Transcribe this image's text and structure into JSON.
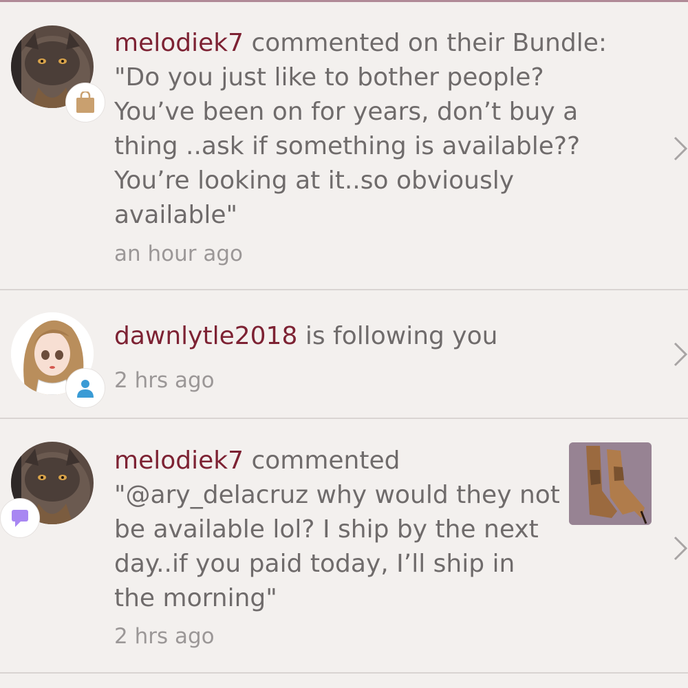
{
  "feed": {
    "items": [
      {
        "username": "melodiek7",
        "action": " commented on their Bundle:",
        "comment": "\"Do you just like to bother people? You’ve been on for years, don’t buy a thing ..ask if something is available?? You’re looking at it..so obviously available\"",
        "time": "an hour ago",
        "avatar": "cat-avatar",
        "badge_icon": "shopping-bag-icon",
        "badge_color": "#c9a06f"
      },
      {
        "username": "dawnlytle2018",
        "action": " is following you",
        "time": "2 hrs ago",
        "avatar": "cartoon-girl-avatar",
        "badge_icon": "person-icon",
        "badge_color": "#3a9bd5"
      },
      {
        "username": "melodiek7",
        "action": " commented",
        "comment": "\"@ary_delacruz why would they not be available lol? I ship by the next day..if you paid today, I’ll ship in the morning\"",
        "time": "2 hrs ago",
        "avatar": "cat-avatar",
        "badge_icon": "speech-bubble-icon",
        "badge_color": "#a887f2",
        "thumbnail": "brown-boots-thumbnail"
      }
    ]
  },
  "colors": {
    "background": "#f3f0ee",
    "username": "#7d2233",
    "text": "#6f6b6b",
    "time": "#9b9797",
    "divider": "#d9d4d2"
  }
}
